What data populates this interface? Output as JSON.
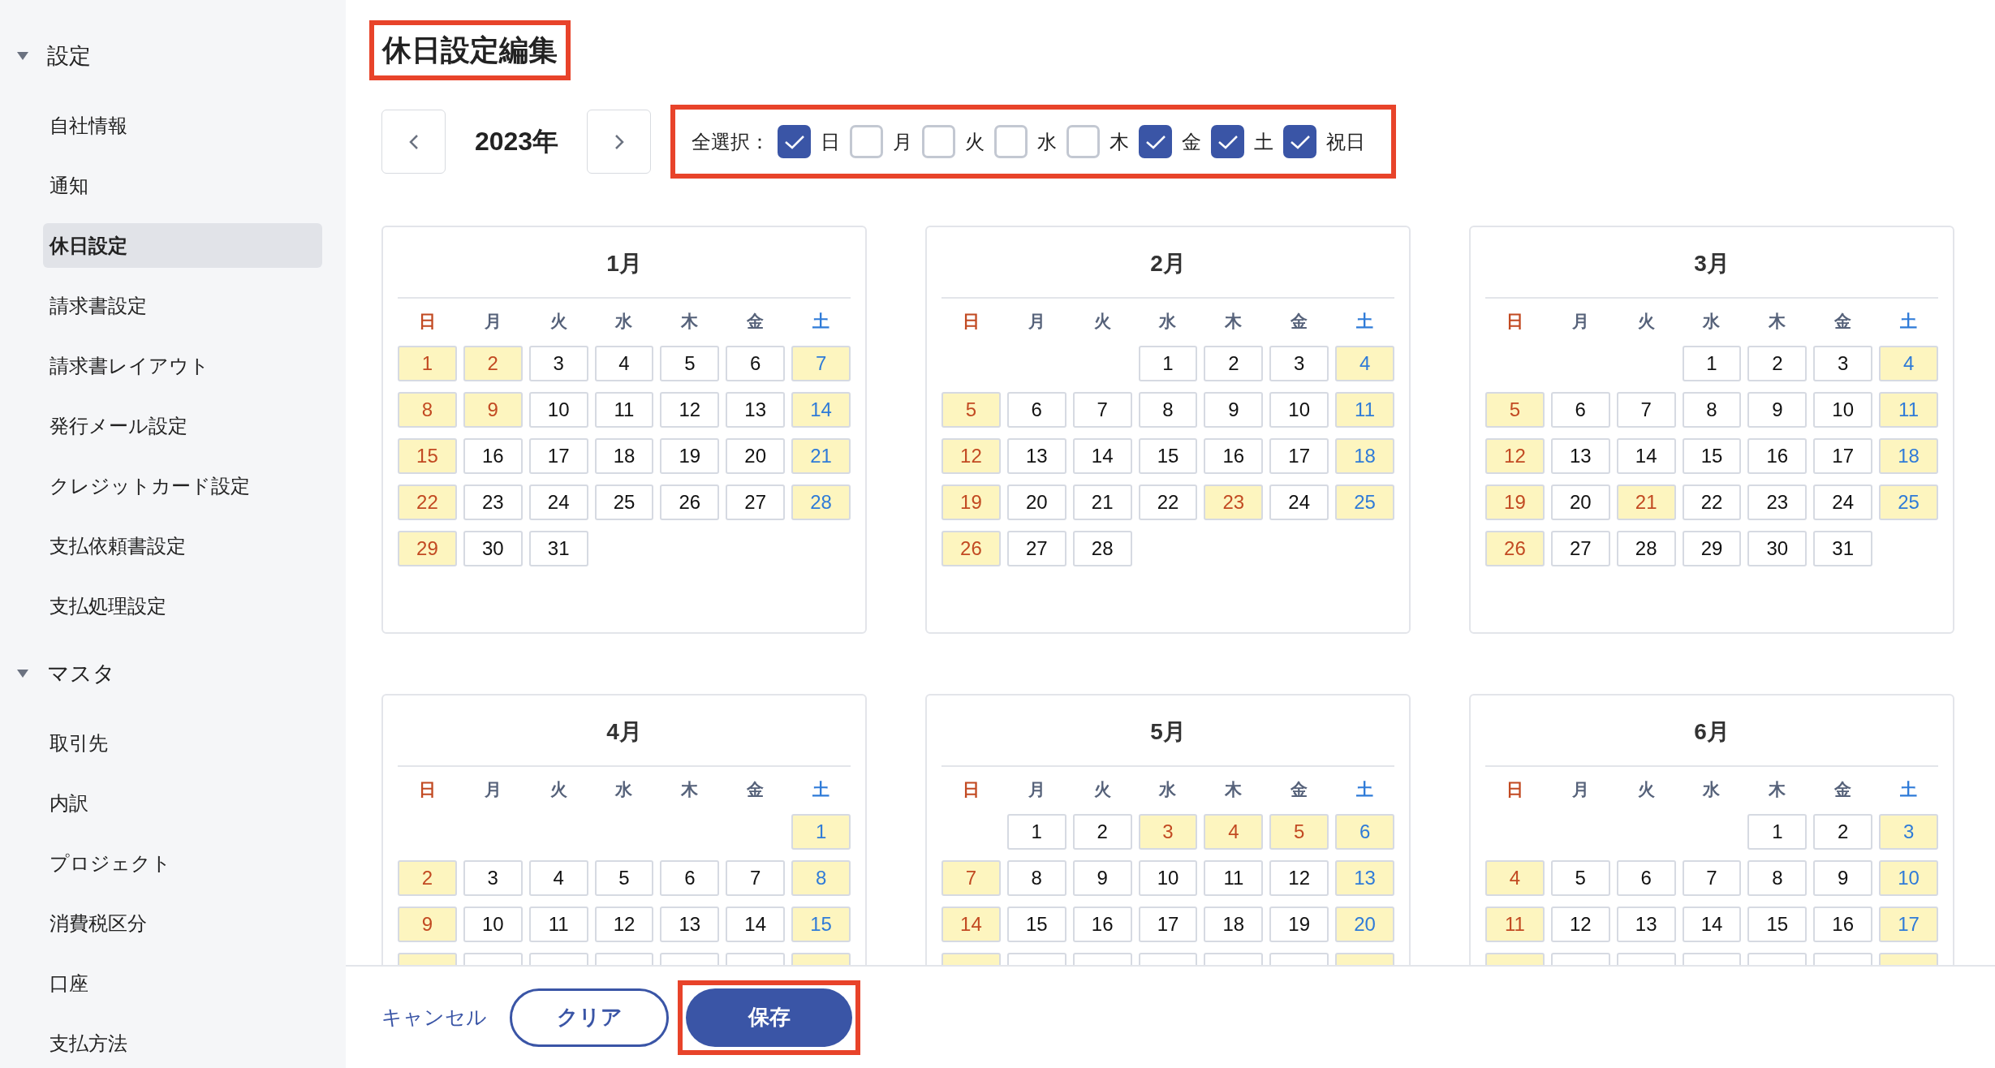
{
  "sidebar": {
    "sections": [
      {
        "title": "設定",
        "expanded": true,
        "items": [
          {
            "label": "自社情報",
            "selected": false
          },
          {
            "label": "通知",
            "selected": false
          },
          {
            "label": "休日設定",
            "selected": true
          },
          {
            "label": "請求書設定",
            "selected": false
          },
          {
            "label": "請求書レイアウト",
            "selected": false
          },
          {
            "label": "発行メール設定",
            "selected": false
          },
          {
            "label": "クレジットカード設定",
            "selected": false
          },
          {
            "label": "支払依頼書設定",
            "selected": false
          },
          {
            "label": "支払処理設定",
            "selected": false
          }
        ]
      },
      {
        "title": "マスタ",
        "expanded": true,
        "items": [
          {
            "label": "取引先",
            "selected": false
          },
          {
            "label": "内訳",
            "selected": false
          },
          {
            "label": "プロジェクト",
            "selected": false
          },
          {
            "label": "消費税区分",
            "selected": false
          },
          {
            "label": "口座",
            "selected": false
          },
          {
            "label": "支払方法",
            "selected": false
          }
        ]
      }
    ]
  },
  "page": {
    "title": "休日設定編集",
    "highlighted": true
  },
  "year_nav": {
    "year": "2023年"
  },
  "weekday_filter": {
    "label": "全選択：",
    "highlighted": true,
    "options": [
      {
        "label": "日",
        "checked": true
      },
      {
        "label": "月",
        "checked": false
      },
      {
        "label": "火",
        "checked": false
      },
      {
        "label": "水",
        "checked": false
      },
      {
        "label": "木",
        "checked": false
      },
      {
        "label": "金",
        "checked": true
      },
      {
        "label": "土",
        "checked": true
      },
      {
        "label": "祝日",
        "checked": true
      }
    ]
  },
  "months": [
    {
      "title": "1月",
      "weekdays": [
        "日",
        "月",
        "火",
        "水",
        "木",
        "金",
        "土"
      ],
      "weeks": [
        [
          {
            "day": "1",
            "holiday": true
          },
          {
            "day": "2",
            "holiday": true
          },
          {
            "day": "3",
            "holiday": false
          },
          {
            "day": "4",
            "holiday": false
          },
          {
            "day": "5",
            "holiday": false
          },
          {
            "day": "6",
            "holiday": false
          },
          {
            "day": "7",
            "holiday": true
          }
        ],
        [
          {
            "day": "8",
            "holiday": true
          },
          {
            "day": "9",
            "holiday": true
          },
          {
            "day": "10",
            "holiday": false
          },
          {
            "day": "11",
            "holiday": false
          },
          {
            "day": "12",
            "holiday": false
          },
          {
            "day": "13",
            "holiday": false
          },
          {
            "day": "14",
            "holiday": true
          }
        ],
        [
          {
            "day": "15",
            "holiday": true
          },
          {
            "day": "16",
            "holiday": false
          },
          {
            "day": "17",
            "holiday": false
          },
          {
            "day": "18",
            "holiday": false
          },
          {
            "day": "19",
            "holiday": false
          },
          {
            "day": "20",
            "holiday": false
          },
          {
            "day": "21",
            "holiday": true
          }
        ],
        [
          {
            "day": "22",
            "holiday": true
          },
          {
            "day": "23",
            "holiday": false
          },
          {
            "day": "24",
            "holiday": false
          },
          {
            "day": "25",
            "holiday": false
          },
          {
            "day": "26",
            "holiday": false
          },
          {
            "day": "27",
            "holiday": false
          },
          {
            "day": "28",
            "holiday": true
          }
        ],
        [
          {
            "day": "29",
            "holiday": true
          },
          {
            "day": "30",
            "holiday": false
          },
          {
            "day": "31",
            "holiday": false
          }
        ]
      ]
    },
    {
      "title": "2月",
      "weekdays": [
        "日",
        "月",
        "火",
        "水",
        "木",
        "金",
        "土"
      ],
      "weeks": [
        [
          {
            "day": "1",
            "holiday": false
          },
          {
            "day": "2",
            "holiday": false
          },
          {
            "day": "3",
            "holiday": false
          },
          {
            "day": "4",
            "holiday": true
          }
        ],
        [
          {
            "day": "5",
            "holiday": true
          },
          {
            "day": "6",
            "holiday": false
          },
          {
            "day": "7",
            "holiday": false
          },
          {
            "day": "8",
            "holiday": false
          },
          {
            "day": "9",
            "holiday": false
          },
          {
            "day": "10",
            "holiday": false
          },
          {
            "day": "11",
            "holiday": true
          }
        ],
        [
          {
            "day": "12",
            "holiday": true
          },
          {
            "day": "13",
            "holiday": false
          },
          {
            "day": "14",
            "holiday": false
          },
          {
            "day": "15",
            "holiday": false
          },
          {
            "day": "16",
            "holiday": false
          },
          {
            "day": "17",
            "holiday": false
          },
          {
            "day": "18",
            "holiday": true
          }
        ],
        [
          {
            "day": "19",
            "holiday": true
          },
          {
            "day": "20",
            "holiday": false
          },
          {
            "day": "21",
            "holiday": false
          },
          {
            "day": "22",
            "holiday": false
          },
          {
            "day": "23",
            "holiday": true
          },
          {
            "day": "24",
            "holiday": false
          },
          {
            "day": "25",
            "holiday": true
          }
        ],
        [
          {
            "day": "26",
            "holiday": true
          },
          {
            "day": "27",
            "holiday": false
          },
          {
            "day": "28",
            "holiday": false
          }
        ]
      ]
    },
    {
      "title": "3月",
      "weekdays": [
        "日",
        "月",
        "火",
        "水",
        "木",
        "金",
        "土"
      ],
      "weeks": [
        [
          {
            "day": "1",
            "holiday": false
          },
          {
            "day": "2",
            "holiday": false
          },
          {
            "day": "3",
            "holiday": false
          },
          {
            "day": "4",
            "holiday": true
          }
        ],
        [
          {
            "day": "5",
            "holiday": true
          },
          {
            "day": "6",
            "holiday": false
          },
          {
            "day": "7",
            "holiday": false
          },
          {
            "day": "8",
            "holiday": false
          },
          {
            "day": "9",
            "holiday": false
          },
          {
            "day": "10",
            "holiday": false
          },
          {
            "day": "11",
            "holiday": true
          }
        ],
        [
          {
            "day": "12",
            "holiday": true
          },
          {
            "day": "13",
            "holiday": false
          },
          {
            "day": "14",
            "holiday": false
          },
          {
            "day": "15",
            "holiday": false
          },
          {
            "day": "16",
            "holiday": false
          },
          {
            "day": "17",
            "holiday": false
          },
          {
            "day": "18",
            "holiday": true
          }
        ],
        [
          {
            "day": "19",
            "holiday": true
          },
          {
            "day": "20",
            "holiday": false
          },
          {
            "day": "21",
            "holiday": true
          },
          {
            "day": "22",
            "holiday": false
          },
          {
            "day": "23",
            "holiday": false
          },
          {
            "day": "24",
            "holiday": false
          },
          {
            "day": "25",
            "holiday": true
          }
        ],
        [
          {
            "day": "26",
            "holiday": true
          },
          {
            "day": "27",
            "holiday": false
          },
          {
            "day": "28",
            "holiday": false
          },
          {
            "day": "29",
            "holiday": false
          },
          {
            "day": "30",
            "holiday": false
          },
          {
            "day": "31",
            "holiday": false
          }
        ]
      ]
    },
    {
      "title": "4月",
      "weekdays": [
        "日",
        "月",
        "火",
        "水",
        "木",
        "金",
        "土"
      ],
      "weeks": [
        [
          {
            "day": "1",
            "holiday": true
          }
        ],
        [
          {
            "day": "2",
            "holiday": true
          },
          {
            "day": "3",
            "holiday": false
          },
          {
            "day": "4",
            "holiday": false
          },
          {
            "day": "5",
            "holiday": false
          },
          {
            "day": "6",
            "holiday": false
          },
          {
            "day": "7",
            "holiday": false
          },
          {
            "day": "8",
            "holiday": true
          }
        ],
        [
          {
            "day": "9",
            "holiday": true
          },
          {
            "day": "10",
            "holiday": false
          },
          {
            "day": "11",
            "holiday": false
          },
          {
            "day": "12",
            "holiday": false
          },
          {
            "day": "13",
            "holiday": false
          },
          {
            "day": "14",
            "holiday": false
          },
          {
            "day": "15",
            "holiday": true
          }
        ],
        [
          {
            "holiday": true
          },
          {
            "holiday": false
          },
          {
            "holiday": false
          },
          {
            "holiday": false
          },
          {
            "holiday": false
          },
          {
            "holiday": false
          },
          {
            "holiday": true
          }
        ]
      ]
    },
    {
      "title": "5月",
      "weekdays": [
        "日",
        "月",
        "火",
        "水",
        "木",
        "金",
        "土"
      ],
      "weeks": [
        [
          {
            "day": "1",
            "holiday": false
          },
          {
            "day": "2",
            "holiday": false
          },
          {
            "day": "3",
            "holiday": true
          },
          {
            "day": "4",
            "holiday": true
          },
          {
            "day": "5",
            "holiday": true
          },
          {
            "day": "6",
            "holiday": true
          }
        ],
        [
          {
            "day": "7",
            "holiday": true
          },
          {
            "day": "8",
            "holiday": false
          },
          {
            "day": "9",
            "holiday": false
          },
          {
            "day": "10",
            "holiday": false
          },
          {
            "day": "11",
            "holiday": false
          },
          {
            "day": "12",
            "holiday": false
          },
          {
            "day": "13",
            "holiday": true
          }
        ],
        [
          {
            "day": "14",
            "holiday": true
          },
          {
            "day": "15",
            "holiday": false
          },
          {
            "day": "16",
            "holiday": false
          },
          {
            "day": "17",
            "holiday": false
          },
          {
            "day": "18",
            "holiday": false
          },
          {
            "day": "19",
            "holiday": false
          },
          {
            "day": "20",
            "holiday": true
          }
        ],
        [
          {
            "holiday": true
          },
          {
            "holiday": false
          },
          {
            "holiday": false
          },
          {
            "holiday": false
          },
          {
            "holiday": false
          },
          {
            "holiday": false
          },
          {
            "holiday": true
          }
        ]
      ]
    },
    {
      "title": "6月",
      "weekdays": [
        "日",
        "月",
        "火",
        "水",
        "木",
        "金",
        "土"
      ],
      "weeks": [
        [
          {
            "day": "1",
            "holiday": false
          },
          {
            "day": "2",
            "holiday": false
          },
          {
            "day": "3",
            "holiday": true
          }
        ],
        [
          {
            "day": "4",
            "holiday": true
          },
          {
            "day": "5",
            "holiday": false
          },
          {
            "day": "6",
            "holiday": false
          },
          {
            "day": "7",
            "holiday": false
          },
          {
            "day": "8",
            "holiday": false
          },
          {
            "day": "9",
            "holiday": false
          },
          {
            "day": "10",
            "holiday": true
          }
        ],
        [
          {
            "day": "11",
            "holiday": true
          },
          {
            "day": "12",
            "holiday": false
          },
          {
            "day": "13",
            "holiday": false
          },
          {
            "day": "14",
            "holiday": false
          },
          {
            "day": "15",
            "holiday": false
          },
          {
            "day": "16",
            "holiday": false
          },
          {
            "day": "17",
            "holiday": true
          }
        ],
        [
          {
            "holiday": true
          },
          {
            "holiday": false
          },
          {
            "holiday": false
          },
          {
            "holiday": false
          },
          {
            "holiday": false
          },
          {
            "holiday": false
          },
          {
            "holiday": true
          }
        ]
      ]
    }
  ],
  "footer": {
    "cancel": "キャンセル",
    "clear": "クリア",
    "save": {
      "label": "保存",
      "highlighted": true
    }
  }
}
